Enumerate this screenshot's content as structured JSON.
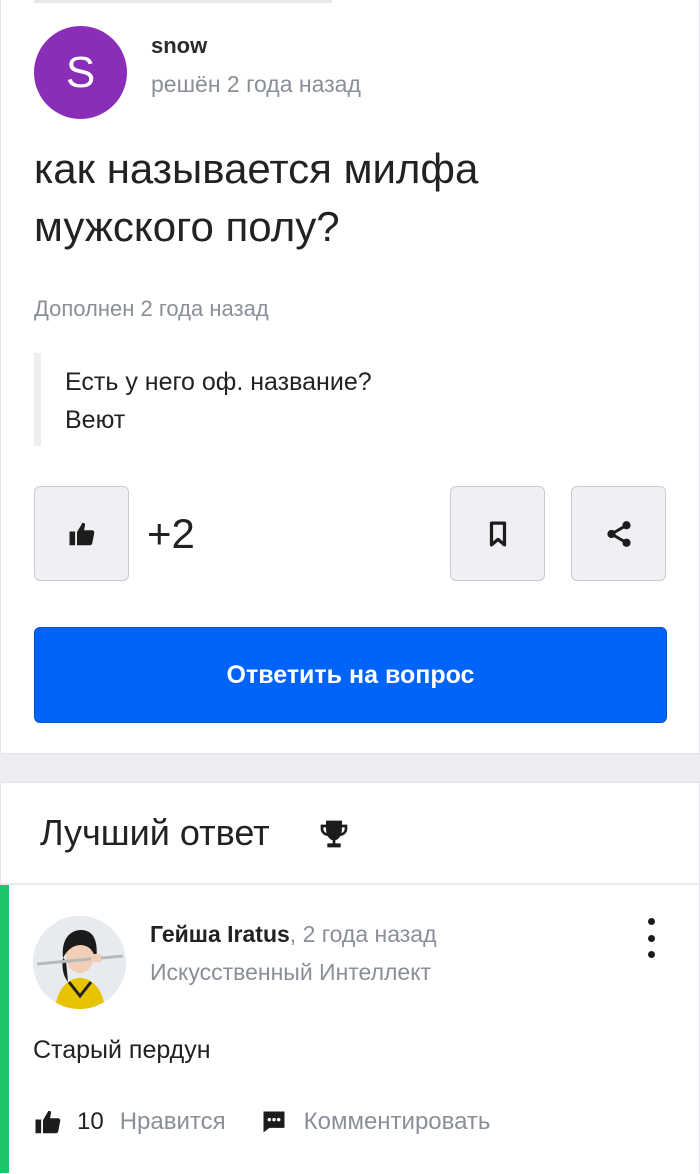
{
  "question": {
    "author": {
      "initial": "S",
      "name": "snow",
      "avatar_color": "#8a2db8"
    },
    "status": "решён 2 года назад",
    "title": "как называется милфа мужского полу?",
    "added_label": "Дополнен 2 года назад",
    "addition_lines": [
      "Есть у него оф. название?",
      "Веют"
    ],
    "score": "+2",
    "actions": {
      "like_icon": "thumbs-up-icon",
      "bookmark_icon": "bookmark-icon",
      "share_icon": "share-icon"
    },
    "answer_button": "Ответить на вопрос",
    "accent_color": "#0064fa"
  },
  "best_answer": {
    "heading": "Лучший ответ",
    "heading_icon": "trophy-icon",
    "accent_color": "#1ec46a",
    "author": {
      "name": "Гейша Iratus",
      "time": ", 2 года назад",
      "rank": "Искусственный Интеллект"
    },
    "text": "Старый пердун",
    "likes": "10",
    "like_label": "Нравится",
    "comment_label": "Комментировать"
  }
}
